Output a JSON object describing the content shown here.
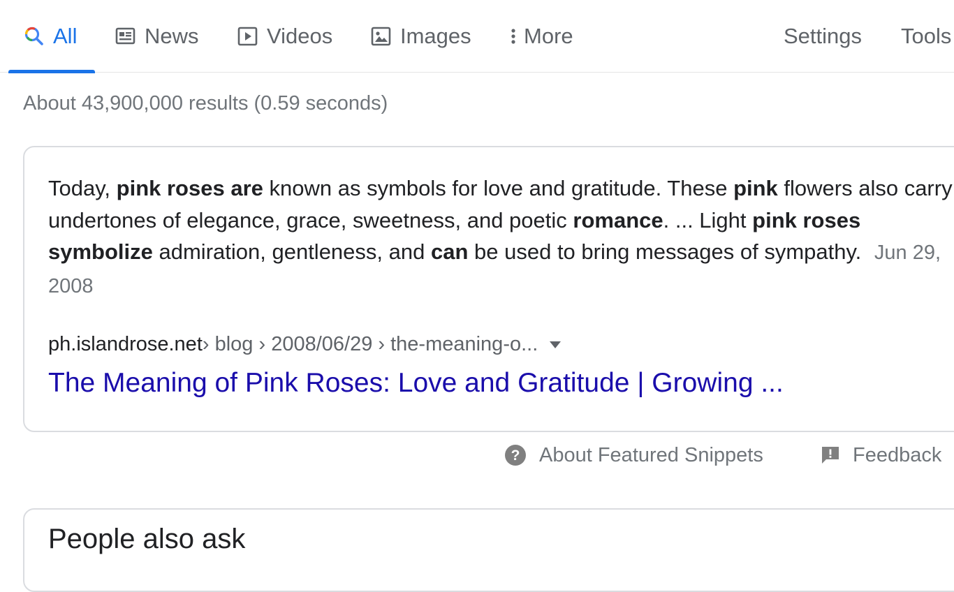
{
  "tabs": {
    "all": "All",
    "news": "News",
    "videos": "Videos",
    "images": "Images",
    "more": "More",
    "settings": "Settings",
    "tools": "Tools"
  },
  "result_stats": "About 43,900,000 results (0.59 seconds)",
  "snippet": {
    "t1": "Today, ",
    "b1": "pink roses are",
    "t2": " known as symbols for love and gratitude. These ",
    "b2": "pink",
    "t3": " flowers also carry undertones of elegance, grace, sweetness, and poetic ",
    "b3": "romance",
    "t4": ". ... Light ",
    "b4": "pink roses symbolize",
    "t5": " admiration, gentleness, and ",
    "b5": "can",
    "t6": " be used to bring messages of sympathy.",
    "date": "Jun 29, 2008"
  },
  "citation": {
    "domain": "ph.islandrose.net",
    "path": " › blog › 2008/06/29 › the-meaning-o..."
  },
  "result_title": "The Meaning of Pink Roses: Love and Gratitude | Growing ...",
  "footer": {
    "about": "About Featured Snippets",
    "feedback": "Feedback"
  },
  "people_also_ask": "People also ask",
  "colors": {
    "accent": "#1a73e8",
    "link": "#1a0dab",
    "muted": "#70757a"
  }
}
